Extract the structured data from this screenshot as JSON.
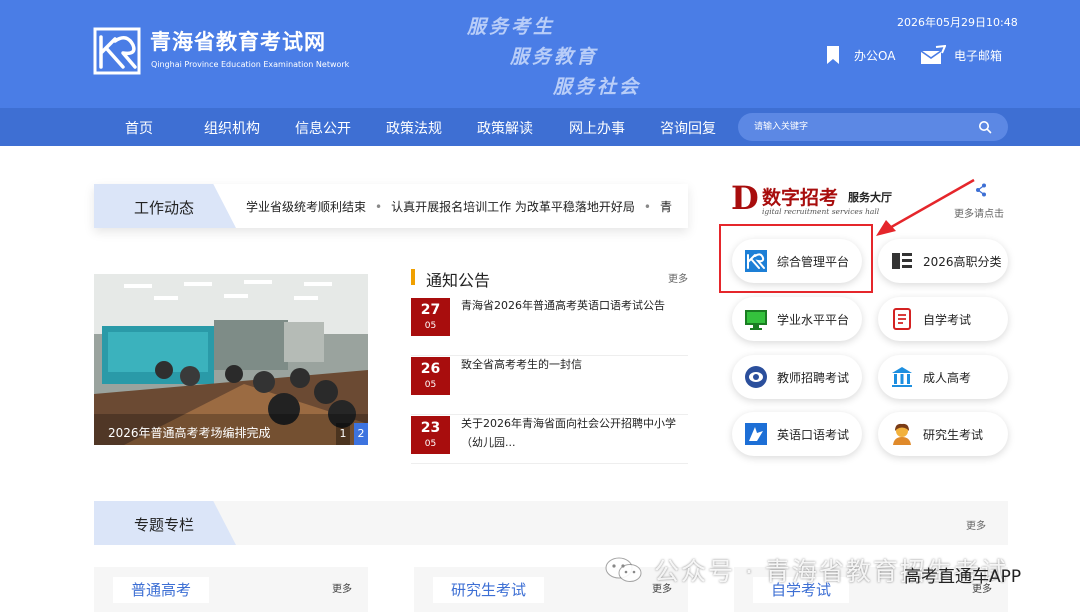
{
  "header": {
    "site_title": "青海省教育考试网",
    "site_subtitle": "Qinghai Province Education Examination Network",
    "slogans": [
      "服务考生",
      "服务教育",
      "服务社会"
    ],
    "datetime": "2026年05月29日10:48",
    "office_oa": "办公OA",
    "email": "电子邮箱"
  },
  "nav": {
    "items": [
      "首页",
      "组织机构",
      "信息公开",
      "政策法规",
      "政策解读",
      "网上办事",
      "咨询回复"
    ],
    "search_placeholder": "请输入关键字"
  },
  "work_news": {
    "label": "工作动态",
    "ticker": [
      "学业省级统考顺利结束",
      "认真开展报名培训工作 为改革平稳落地开好局",
      "青"
    ]
  },
  "carousel": {
    "caption": "2026年普通高考考场编排完成",
    "pages": [
      "1",
      "2"
    ],
    "active_page": 2
  },
  "notices": {
    "title": "通知公告",
    "more": "更多",
    "items": [
      {
        "day": "27",
        "month": "05",
        "text": "青海省2026年普通高考英语口语考试公告"
      },
      {
        "day": "26",
        "month": "05",
        "text": "致全省高考考生的一封信"
      },
      {
        "day": "23",
        "month": "05",
        "text": "关于2026年青海省面向社会公开招聘中小学（幼儿园..."
      }
    ]
  },
  "digital_hall": {
    "logo_letter": "D",
    "logo_main": "数字招考",
    "logo_side": "服务大厅",
    "logo_en": "igital recruitment services hall",
    "more": "更多请点击",
    "services": [
      {
        "label": "综合管理平台",
        "icon": "management-platform-icon"
      },
      {
        "label": "2026高职分类",
        "icon": "vocational-classification-icon"
      },
      {
        "label": "学业水平平台",
        "icon": "academic-level-icon"
      },
      {
        "label": "自学考试",
        "icon": "self-study-exam-icon"
      },
      {
        "label": "教师招聘考试",
        "icon": "teacher-recruitment-icon"
      },
      {
        "label": "成人高考",
        "icon": "adult-exam-icon"
      },
      {
        "label": "英语口语考试",
        "icon": "english-oral-icon"
      },
      {
        "label": "研究生考试",
        "icon": "graduate-exam-icon"
      }
    ],
    "highlight_color": "#e5262b"
  },
  "special_column": {
    "label": "专题专栏",
    "more": "更多",
    "cards": [
      {
        "tab": "普通高考",
        "more": "更多"
      },
      {
        "tab": "研究生考试",
        "more": "更多"
      },
      {
        "tab": "自学考试",
        "more": "更多"
      }
    ]
  },
  "watermark": {
    "text": "公众号 · 青海省教育招生考试",
    "text2": "高考直通车APP"
  },
  "colors": {
    "header_bg": "#4a7de6",
    "nav_bg": "#3e6fd3",
    "date_box": "#a80d0d",
    "accent_orange": "#f0a000"
  }
}
